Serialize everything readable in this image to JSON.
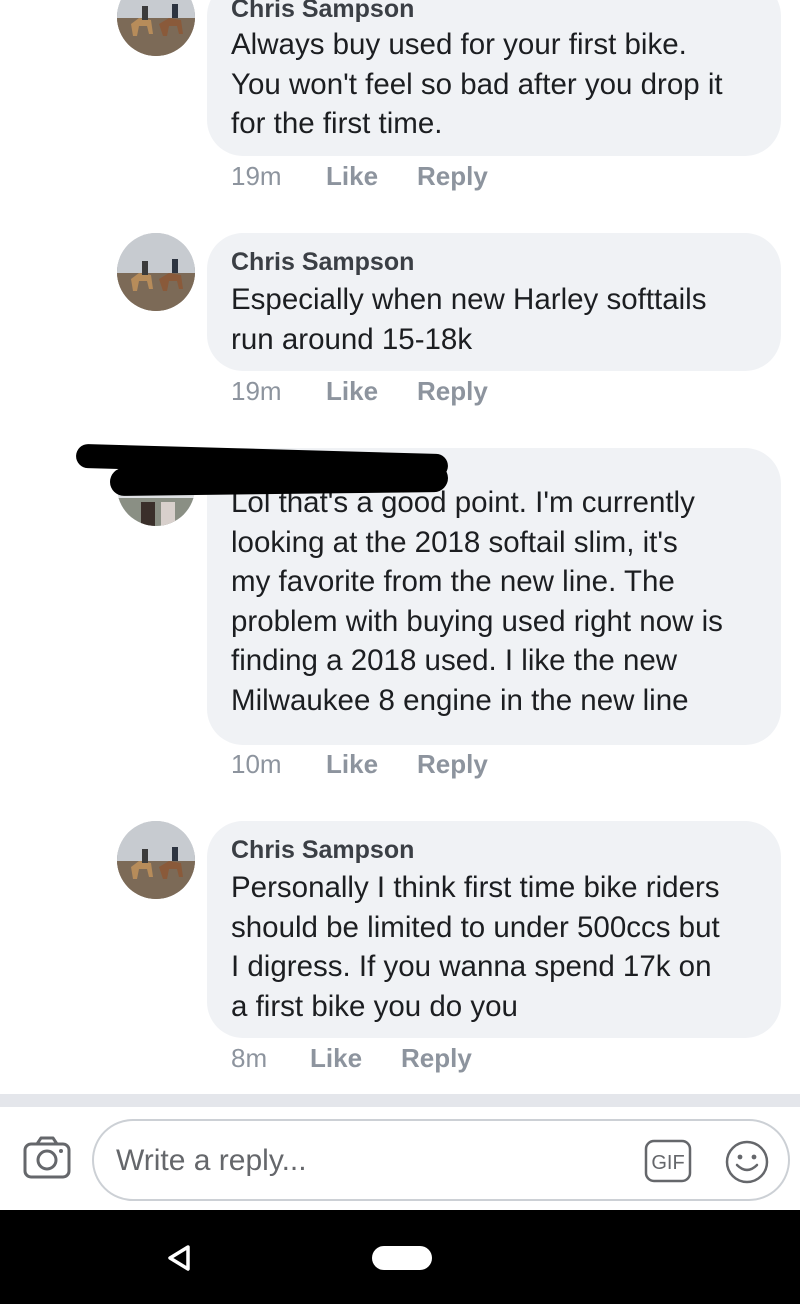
{
  "comments": [
    {
      "author": "Chris Sampson",
      "text": "Always buy used for your first bike.\nYou won't feel so bad after you drop it\nfor the first time.",
      "time": "19m",
      "like": "Like",
      "reply": "Reply"
    },
    {
      "author": "Chris Sampson",
      "text": "Especially when new Harley softtails\nrun around 15-18k",
      "time": "19m",
      "like": "Like",
      "reply": "Reply"
    },
    {
      "author": "",
      "text": "Lol that's a good point. I'm currently\nlooking at the 2018 softail slim, it's\nmy favorite from the new line. The\nproblem with buying used right now is\nfinding a 2018 used. I like the new\nMilwaukee 8 engine in the new line",
      "time": "10m",
      "like": "Like",
      "reply": "Reply"
    },
    {
      "author": "Chris Sampson",
      "text": "Personally I think first time bike riders\nshould be limited to under 500ccs but\nI digress. If you wanna spend 17k on\na first bike you do you",
      "time": "8m",
      "like": "Like",
      "reply": "Reply"
    }
  ],
  "composer": {
    "placeholder": "Write a reply...",
    "gif_label": "GIF",
    "icons": [
      "camera-icon",
      "gif-icon",
      "emoji-icon"
    ]
  },
  "navbar": {
    "icons": [
      "back-icon",
      "home-pill"
    ]
  },
  "colors": {
    "bubble": "#f0f2f5",
    "meta": "#8d949e",
    "text": "#1c1e21",
    "navbar": "#000000"
  }
}
